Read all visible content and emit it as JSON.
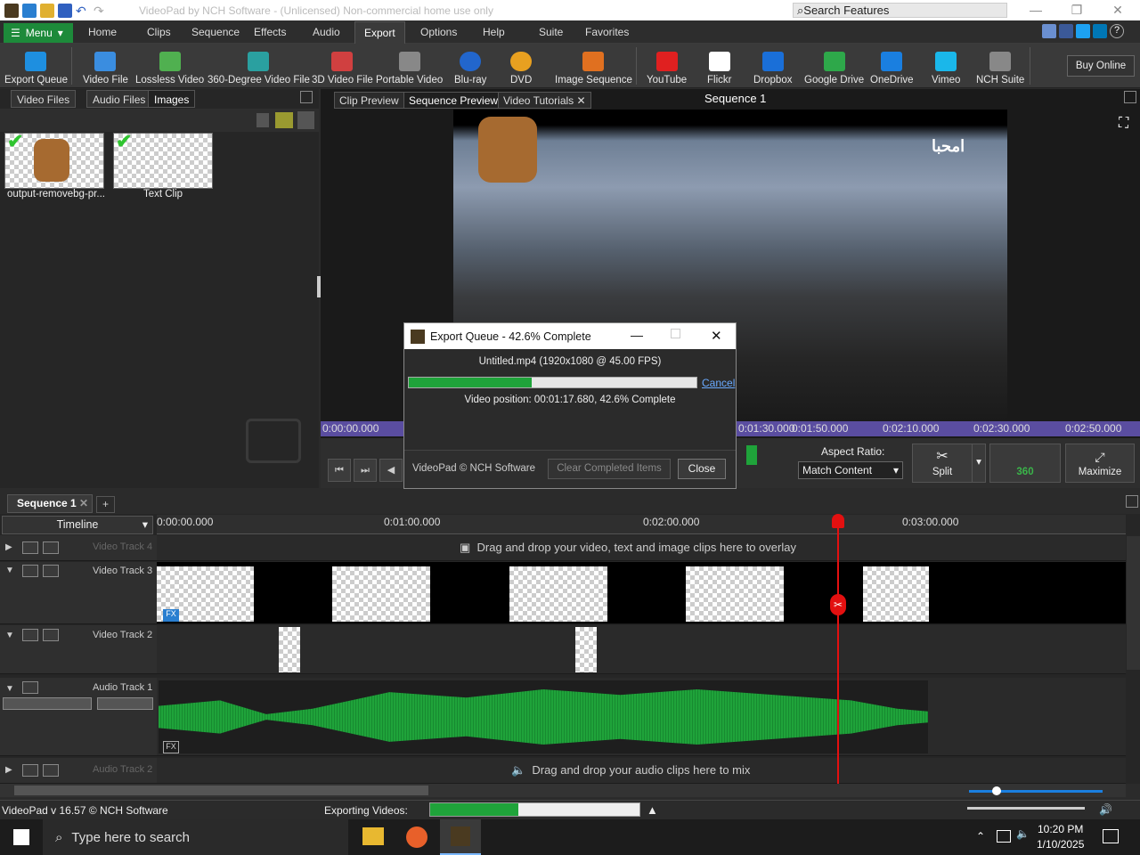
{
  "window": {
    "title": "VideoPad by NCH Software - (Unlicensed) Non-commercial home use only",
    "search_placeholder": "Search Features"
  },
  "menu_label": "Menu",
  "tabs": [
    "Home",
    "Clips",
    "Sequence",
    "Effects",
    "Audio",
    "Export",
    "Options",
    "Help",
    "Suite",
    "Favorites"
  ],
  "active_tab": "Export",
  "toolbar": [
    {
      "label": "Export Queue",
      "icon": "export-queue-icon",
      "color": "#1e8fe0"
    },
    {
      "label": "Video File",
      "icon": "video-file-icon",
      "color": "#3a8de0"
    },
    {
      "label": "Lossless Video",
      "icon": "lossless-video-icon",
      "color": "#50b050"
    },
    {
      "label": "360-Degree Video File",
      "icon": "360-video-icon",
      "color": "#2aa0a0"
    },
    {
      "label": "3D Video File",
      "icon": "3d-glasses-icon",
      "color": "#d04040"
    },
    {
      "label": "Portable Video",
      "icon": "portable-video-icon",
      "color": "#888888"
    },
    {
      "label": "Blu-ray",
      "icon": "bluray-disc-icon",
      "color": "#2266cc"
    },
    {
      "label": "DVD",
      "icon": "dvd-disc-icon",
      "color": "#e8a020"
    },
    {
      "label": "Image Sequence",
      "icon": "image-sequence-icon",
      "color": "#e07020"
    },
    {
      "label": "YouTube",
      "icon": "youtube-icon",
      "color": "#e02020"
    },
    {
      "label": "Flickr",
      "icon": "flickr-icon",
      "color": "#ffffff"
    },
    {
      "label": "Dropbox",
      "icon": "dropbox-icon",
      "color": "#1a6fd8"
    },
    {
      "label": "Google Drive",
      "icon": "google-drive-icon",
      "color": "#2ea84a"
    },
    {
      "label": "OneDrive",
      "icon": "onedrive-icon",
      "color": "#1a7fe0"
    },
    {
      "label": "Vimeo",
      "icon": "vimeo-icon",
      "color": "#1ab7ea"
    },
    {
      "label": "NCH Suite",
      "icon": "nch-suite-icon",
      "color": "#888888"
    }
  ],
  "buy_online": "Buy Online",
  "bins": {
    "tabs": [
      "Video Files",
      "Audio Files",
      "Images"
    ],
    "active": "Images",
    "items": [
      {
        "label": "output-removebg-pr..."
      },
      {
        "label": "Text Clip"
      }
    ]
  },
  "preview": {
    "tabs": [
      "Clip Preview",
      "Sequence Preview",
      "Video Tutorials"
    ],
    "active": "Sequence Preview",
    "sequence_title": "Sequence 1",
    "video_overlay_text": "امحبا",
    "ruler": [
      "0:00:00.000",
      "0:01:30.000",
      "0:01:50.000",
      "0:02:10.000",
      "0:02:30.000",
      "0:02:50.000"
    ],
    "aspect_label": "Aspect Ratio:",
    "aspect_value": "Match Content",
    "split_label": "Split",
    "btn360_label": "360",
    "maximize_label": "Maximize"
  },
  "dialog": {
    "title": "Export Queue - 42.6% Complete",
    "file": "Untitled.mp4 (1920x1080 @ 45.00 FPS)",
    "progress": 0.426,
    "cancel": "Cancel",
    "position": "Video position:  00:01:17.680, 42.6% Complete",
    "copyright": "VideoPad © NCH Software",
    "clear": "Clear Completed Items",
    "close": "Close"
  },
  "sequence": {
    "tab": "Sequence 1",
    "timeline_label": "Timeline",
    "ruler": [
      "0:00:00.000",
      "0:01:00.000",
      "0:02:00.000",
      "0:03:00.000"
    ],
    "tracks": {
      "v4": "Video Track 4",
      "v3": "Video Track 3",
      "v2": "Video Track 2",
      "a1": "Audio Track 1",
      "a2": "Audio Track 2"
    },
    "overlay_hint": "Drag and drop your video, text and image clips here to overlay",
    "mix_hint": "Drag and drop your audio clips here to mix"
  },
  "status": {
    "version": "VideoPad v 16.57 © NCH Software",
    "exporting": "Exporting Videos:",
    "progress": 0.42
  },
  "taskbar": {
    "search": "Type here to search",
    "time": "10:20 PM",
    "date": "1/10/2025"
  }
}
